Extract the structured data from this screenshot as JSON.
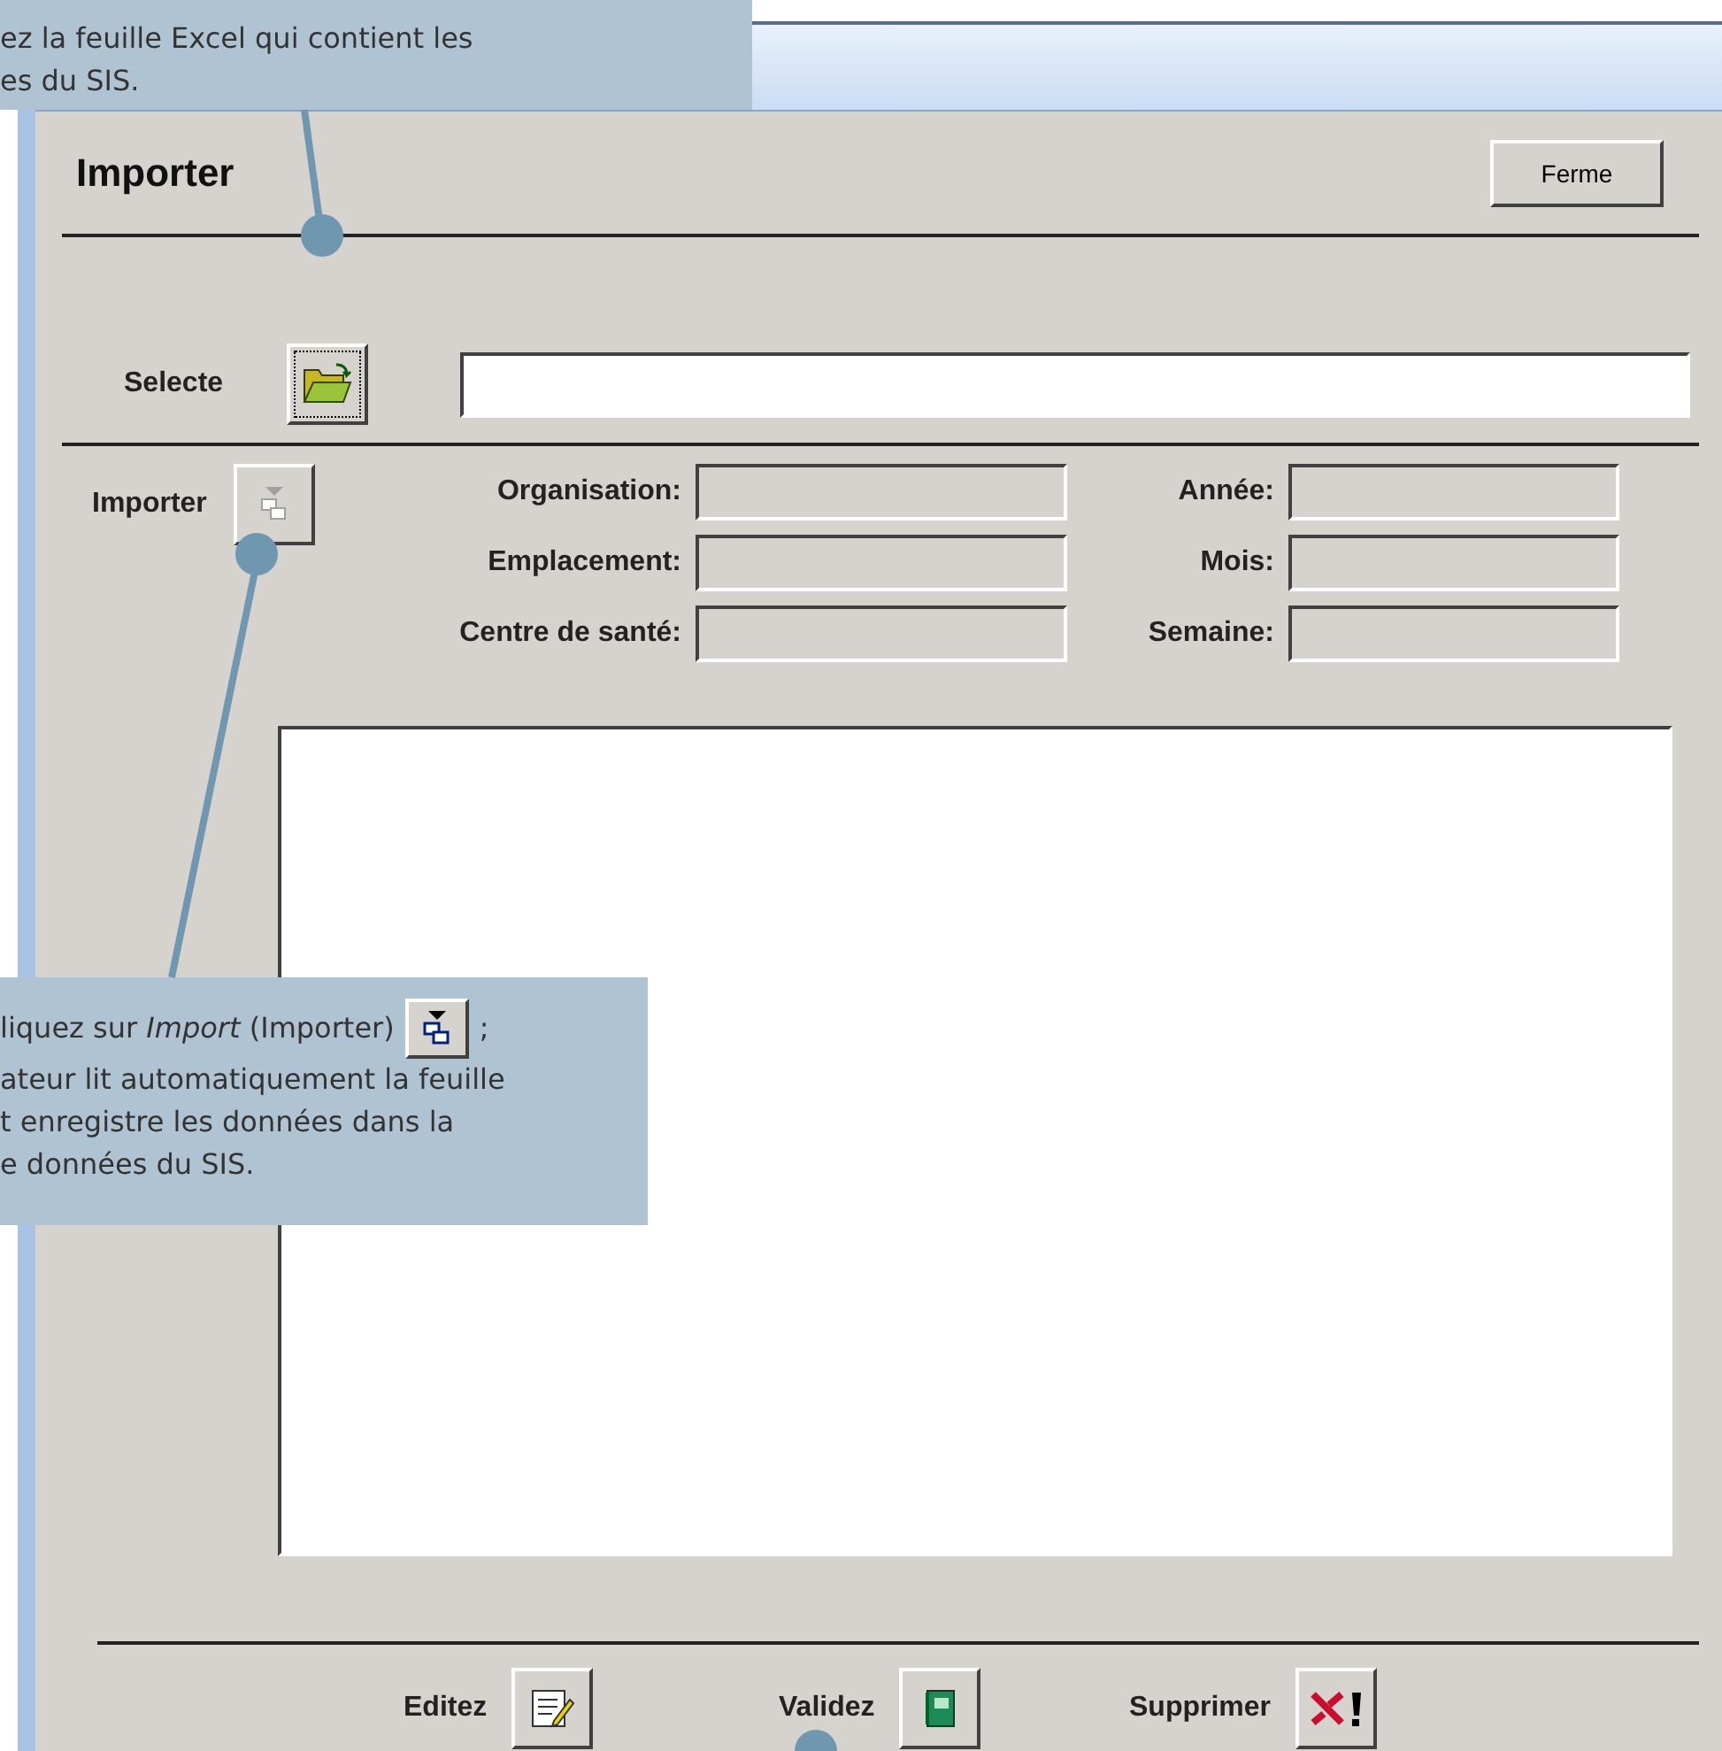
{
  "callout_top": {
    "lines": [
      "ez la feuille Excel qui contient les",
      "es du SIS."
    ]
  },
  "dialog": {
    "title": "Importer",
    "close_button": "Ferme"
  },
  "select_row": {
    "label": "Selecte"
  },
  "import_row": {
    "label": "Importer",
    "button_disabled": true
  },
  "fields_left": [
    {
      "label": "Organisation:",
      "disabled": true
    },
    {
      "label": "Emplacement:",
      "disabled": true
    },
    {
      "label": "Centre de santé:",
      "disabled": true
    }
  ],
  "fields_right": [
    {
      "label": "Année:",
      "disabled": true
    },
    {
      "label": "Mois:",
      "disabled": true
    },
    {
      "label": "Semaine:",
      "disabled": true
    }
  ],
  "actions": [
    {
      "label": "Editez",
      "kind": "edit"
    },
    {
      "label": "Validez",
      "kind": "validate"
    },
    {
      "label": "Supprimer",
      "kind": "delete"
    }
  ],
  "callout_bottom": {
    "first_line": "liquez sur *Import* (Importer)",
    "after_icon": ";",
    "lines": [
      "ateur lit automatiquement la feuille",
      "t enregistre les données dans la",
      "e données du SIS."
    ]
  }
}
